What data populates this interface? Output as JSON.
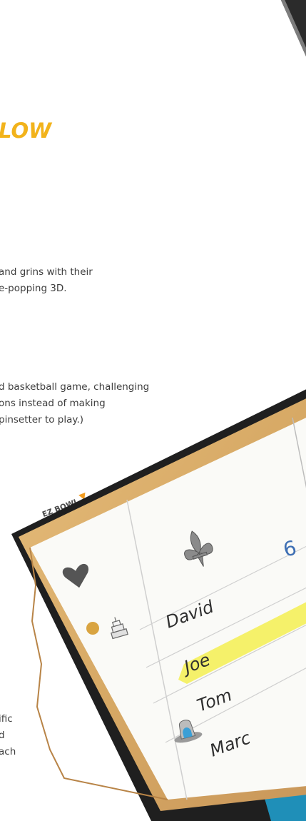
{
  "headline": "LOW",
  "paragraphs": {
    "p1": [
      "and grins with their",
      "e-popping 3D."
    ],
    "p2": [
      "d basketball game, challenging",
      "ons instead of making",
      "pinsetter to play.)"
    ],
    "p3": [
      "ific",
      "d",
      "ach"
    ]
  },
  "scoreboard": {
    "label": "EZ BOWL",
    "players": [
      "David",
      "Joe",
      "Tom",
      "Marc"
    ],
    "score_digit": "6",
    "highlighted_player": "Joe"
  },
  "colors": {
    "headline": "#f2b31b",
    "marker_triangle": "#f39c1f",
    "highlight": "#f4f05a",
    "wood": "#dcae6a",
    "frame": "#2a2a2a",
    "score_ink": "#3e6fb4"
  },
  "icons": [
    "heart-icon",
    "fleur-de-lis-icon",
    "cake-icon",
    "hat-icon"
  ]
}
